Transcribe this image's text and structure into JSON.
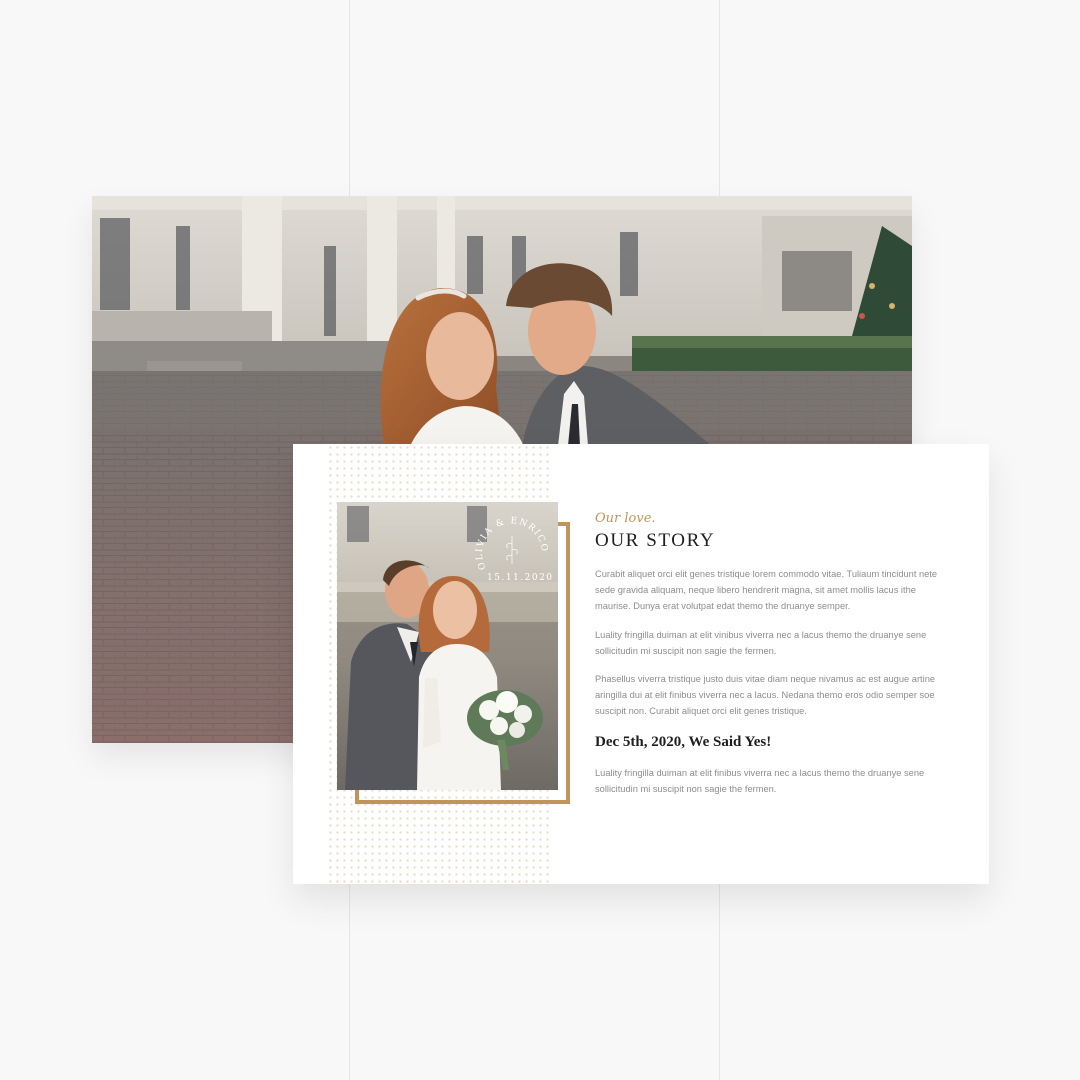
{
  "hero": {
    "image": "couple-kissing-in-front-of-palace-photo"
  },
  "story": {
    "photo": "couple-with-bouquet-photo",
    "badge": {
      "names": "OLIVIA & ENRICO",
      "date": "15.11.2020",
      "icon": "leaf-sprig-icon"
    },
    "tagline": "Our love.",
    "title": "OUR STORY",
    "paragraphs": [
      "Curabit aliquet orci elit genes tristique lorem commodo vitae. Tuliaum tincidunt nete sede gravida aliquam, neque libero hendrerit magna, sit amet mollis lacus ithe maurise. Dunya erat volutpat edat themo the druanye semper.",
      "Luality fringilla duiman at elit vinibus viverra nec a lacus themo the druanye sene sollicitudin mi suscipit non sagie the fermen.",
      "Phasellus viverra tristique justo duis vitae diam neque nivamus ac est augue artine aringilla dui at elit finibus viverra nec a lacus. Nedana themo eros odio semper soe suscipit non. Curabit aliquet orci elit genes tristique."
    ],
    "subheading": "Dec 5th, 2020, We Said Yes!",
    "closing_paragraph": "Luality fringilla duiman at elit finibus viverra nec a lacus themo the druanye sene sollicitudin mi suscipit non sagie the fermen."
  },
  "colors": {
    "accent": "#c0955a",
    "background": "#f8f8f8",
    "panel": "#ffffff",
    "heading": "#1f1f1f",
    "body_text": "#8d8d8d"
  }
}
